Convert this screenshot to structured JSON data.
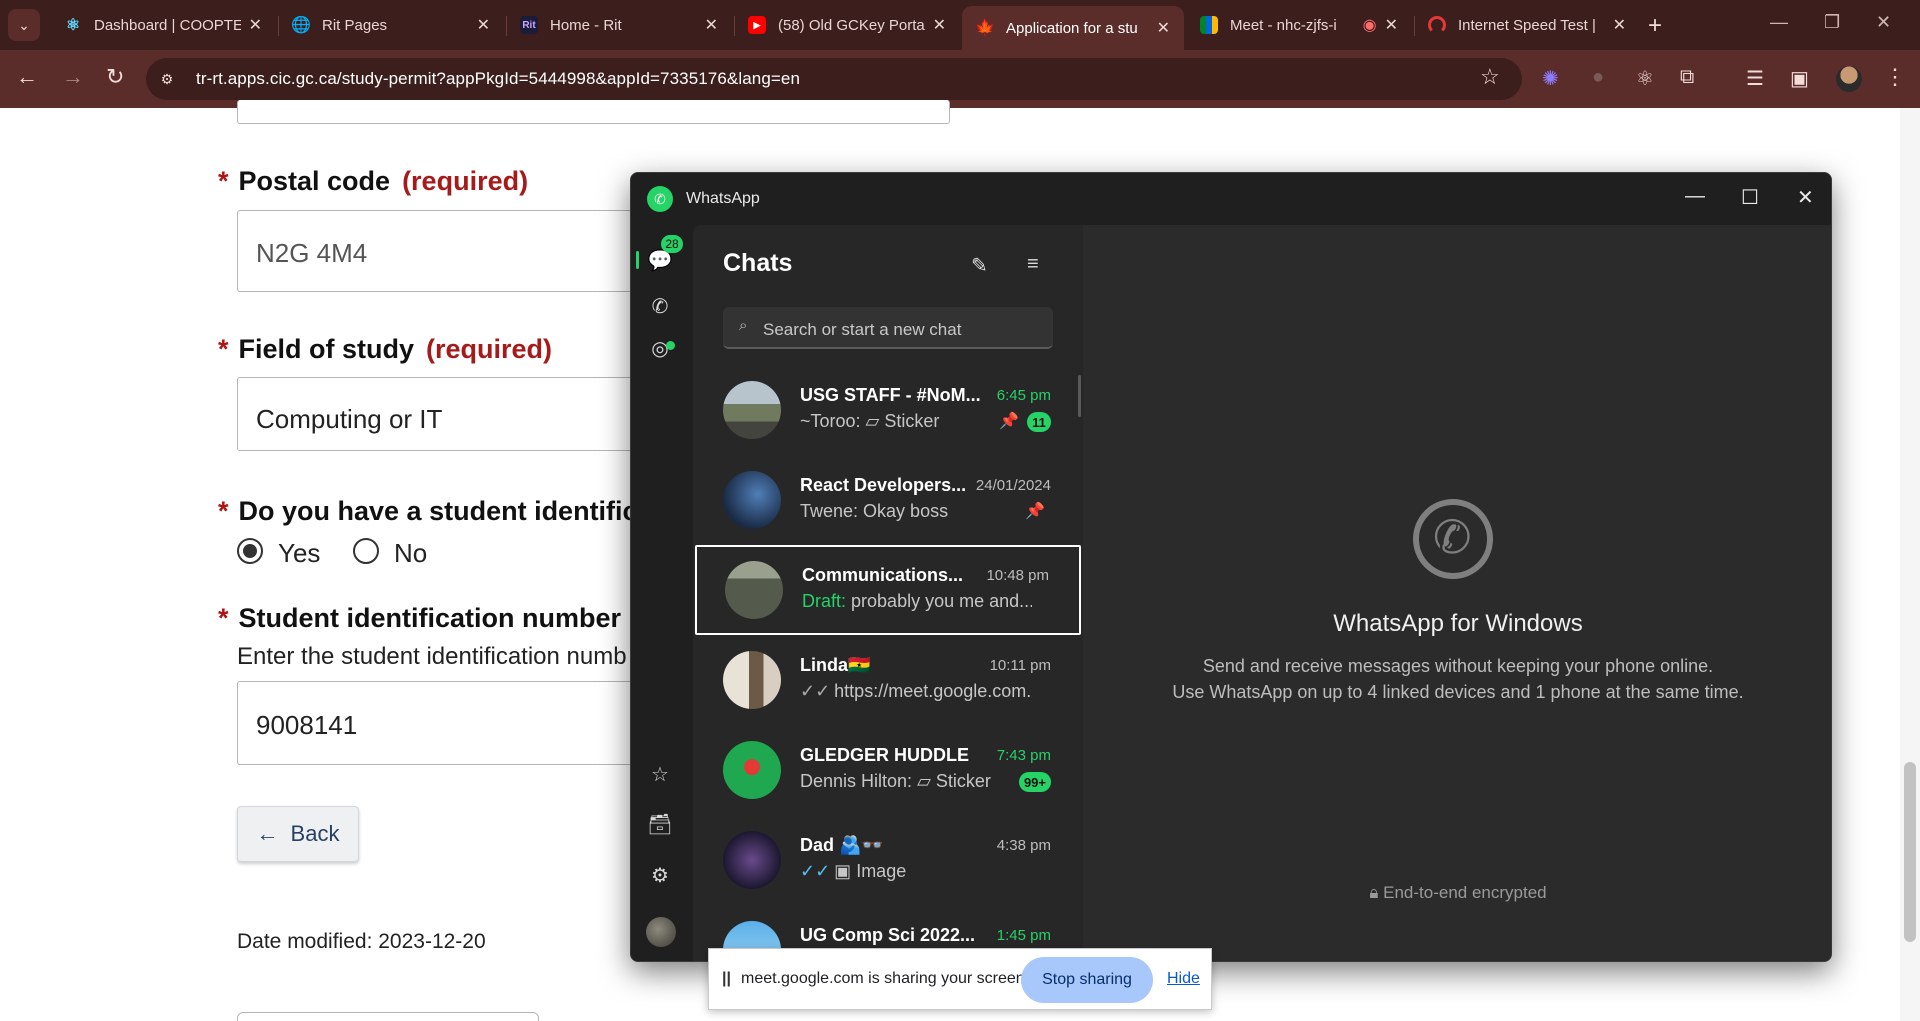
{
  "browser": {
    "tabs": [
      {
        "title": "Dashboard | COOPTE",
        "icon": "react-icon",
        "active": false
      },
      {
        "title": "Rit Pages",
        "icon": "globe-icon",
        "active": false
      },
      {
        "title": "Home - Rit",
        "icon": "rit-icon",
        "active": false
      },
      {
        "title": "(58) Old GCKey Porta",
        "icon": "youtube-icon",
        "active": false
      },
      {
        "title": "Application for a stu",
        "icon": "maple-leaf-icon",
        "active": true
      },
      {
        "title": "Meet - nhc-zjfs-i",
        "icon": "google-meet-icon",
        "active": false
      },
      {
        "title": "Internet Speed Test |",
        "icon": "speedtest-icon",
        "active": false
      }
    ],
    "rit_favicon_text": "Rit",
    "url": "tr-rt.apps.cic.gc.ca/study-permit?appPkgId=5444998&appId=7335176&lang=en",
    "colors": {
      "frame": "#3c1e1c",
      "toolbar": "#5a2d2a"
    }
  },
  "form": {
    "postal_code": {
      "label": "Postal code",
      "required_text": "(required)",
      "value": "N2G 4M4"
    },
    "field_of_study": {
      "label": "Field of study",
      "required_text": "(required)",
      "value": "Computing or IT"
    },
    "student_id_question": {
      "label": "Do you have a student identific",
      "options": [
        "Yes",
        "No"
      ],
      "selected": "Yes"
    },
    "student_id_number": {
      "label": "Student identification number",
      "help": "Enter the student identification numb",
      "value": "9008141"
    },
    "back_button": "Back",
    "date_modified": "Date modified: 2023-12-20"
  },
  "whatsapp": {
    "window_title": "WhatsApp",
    "unread_total": "28",
    "chats_title": "Chats",
    "search_placeholder": "Search or start a new chat",
    "chats": [
      {
        "name": "USG STAFF - #NoM...",
        "time": "6:45 pm",
        "time_green": true,
        "prefix": "~Toroo: ",
        "message": "Sticker",
        "msg_icon": "sticker-icon",
        "unread": "11",
        "pinned": true,
        "avatar": "building-photo"
      },
      {
        "name": "React Developers...",
        "time": "24/01/2024",
        "time_green": false,
        "prefix": "Twene: ",
        "message": "Okay boss",
        "unread": "",
        "pinned": true,
        "avatar": "night-street-photo"
      },
      {
        "name": "Communications...",
        "time": "10:48 pm",
        "time_green": false,
        "draft_label": "Draft:",
        "message": "probably you me and...",
        "unread": "",
        "pinned": false,
        "selected": true,
        "avatar": "person-photo"
      },
      {
        "name": "Linda🇬🇭",
        "time": "10:11 pm",
        "time_green": false,
        "message": "https://meet.google.com...",
        "ticks": "✓✓",
        "unread": "",
        "pinned": false,
        "avatar": "portrait-photo"
      },
      {
        "name": "GLEDGER HUDDLE",
        "time": "7:43 pm",
        "time_green": true,
        "prefix": "Dennis Hilton: ",
        "message": "Sticker",
        "msg_icon": "sticker-icon",
        "unread": "99+",
        "pinned": false,
        "avatar": "green-group-photo"
      },
      {
        "name": "Dad 🫂👓",
        "time": "4:38 pm",
        "time_green": false,
        "message": "Image",
        "msg_icon": "image-icon",
        "ticks": "✓✓",
        "ticks_blue": true,
        "unread": "",
        "pinned": false,
        "avatar": "quote-image"
      },
      {
        "name": "UG Comp Sci 2022...",
        "time": "1:45 pm",
        "time_green": true,
        "message": "",
        "unread": "",
        "pinned": false,
        "avatar": "sky-photo"
      }
    ],
    "welcome": {
      "title": "WhatsApp for Windows",
      "line1": "Send and receive messages without keeping your phone online.",
      "line2": "Use WhatsApp on up to 4 linked devices and 1 phone at the same time.",
      "encrypted": "End-to-end encrypted"
    },
    "colors": {
      "accent": "#25d366",
      "panel": "#272727",
      "main": "#2b2b2b"
    }
  },
  "share_bar": {
    "grip": "||",
    "text": "meet.google.com is sharing your screen.",
    "stop_button": "Stop sharing",
    "hide_link": "Hide"
  }
}
